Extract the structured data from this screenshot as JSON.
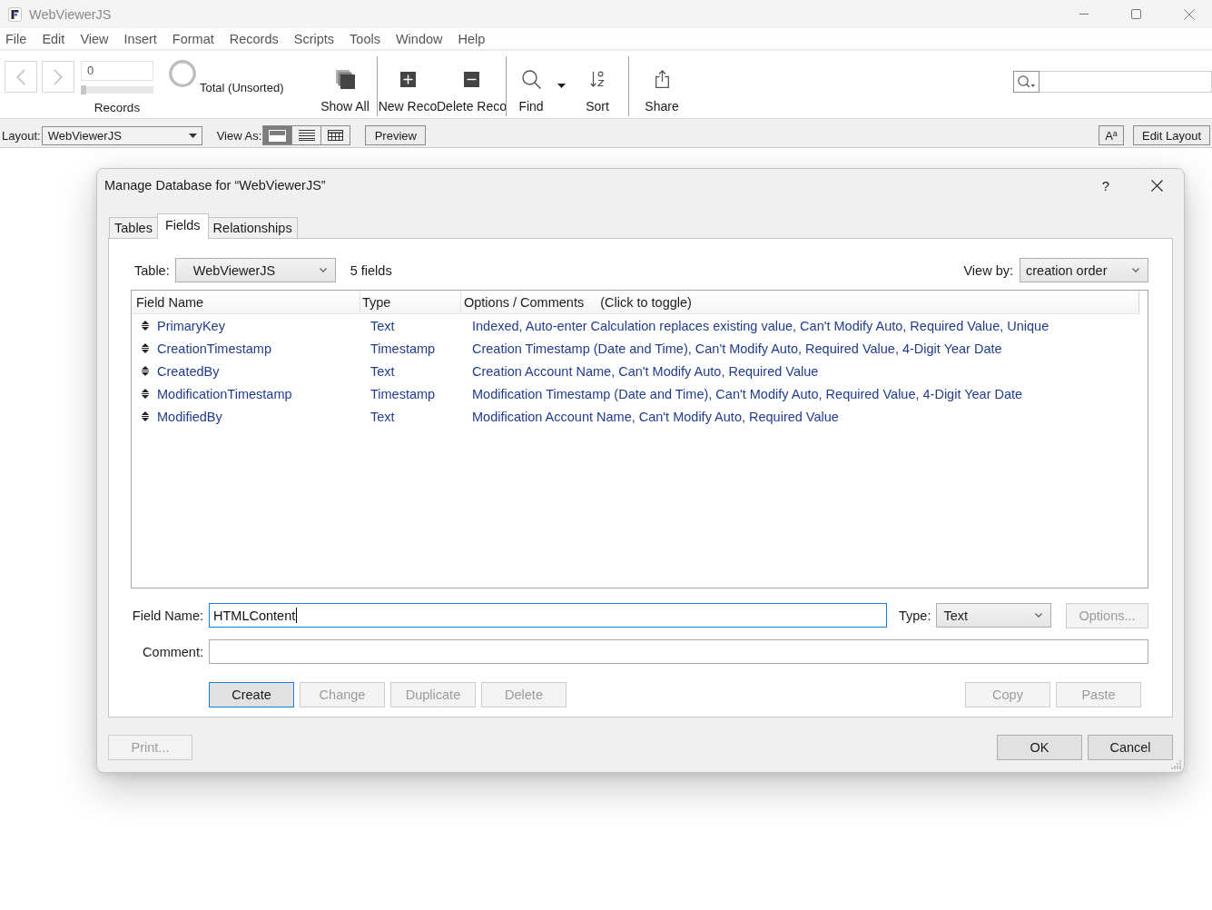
{
  "window": {
    "title": "WebViewerJS"
  },
  "menu": [
    "File",
    "Edit",
    "View",
    "Insert",
    "Format",
    "Records",
    "Scripts",
    "Tools",
    "Window",
    "Help"
  ],
  "toolbar": {
    "record_number": "0",
    "record_slider": {
      "level": 0
    },
    "records_label": "Records",
    "found_status": "Total (Unsorted)",
    "groups": [
      [
        {
          "kind": "show_all",
          "label": "Show All"
        }
      ],
      [
        {
          "kind": "new_record",
          "label": "New Reco"
        },
        {
          "kind": "delete_record",
          "label": "Delete Reco"
        }
      ],
      [
        {
          "kind": "find",
          "label": "Find"
        },
        {
          "kind": "menu_caret"
        },
        {
          "kind": "sort",
          "label": "Sort"
        }
      ],
      [
        {
          "kind": "share",
          "label": "Share"
        }
      ]
    ]
  },
  "layout_bar": {
    "layout_label": "Layout:",
    "layout": "WebViewerJS",
    "view_as_label": "View As:",
    "view_modes": [
      {
        "kind": "form",
        "selected": true
      },
      {
        "kind": "list",
        "selected": false
      },
      {
        "kind": "table",
        "selected": false
      }
    ],
    "preview": "Preview",
    "text_format": "A$^{a}$",
    "edit_layout": "Edit Layout"
  },
  "dialog": {
    "title": "Manage Database for “WebViewerJS”",
    "help": "?",
    "tabs": [
      {
        "label": "Tables",
        "selected": false
      },
      {
        "label": "Fields",
        "selected": true
      },
      {
        "label": "Relationships",
        "selected": false
      }
    ],
    "table_label": "Table:",
    "table": "WebViewerJS",
    "field_count": "5 fields",
    "view_by_label": "View by:",
    "view_by": "creation order",
    "fields_list": {
      "columns": [
        "Field Name",
        "Type",
        "Options / Comments"
      ],
      "toggle_hint": "(Click to toggle)",
      "rows": [
        {
          "name": "PrimaryKey",
          "type": "Text",
          "options": "Indexed, Auto-enter Calculation replaces existing value, Can't Modify Auto, Required Value, Unique"
        },
        {
          "name": "CreationTimestamp",
          "type": "Timestamp",
          "options": "Creation Timestamp (Date and Time), Can't Modify Auto, Required Value, 4-Digit Year Date"
        },
        {
          "name": "CreatedBy",
          "type": "Text",
          "options": "Creation Account Name, Can't Modify Auto, Required Value"
        },
        {
          "name": "ModificationTimestamp",
          "type": "Timestamp",
          "options": "Modification Timestamp (Date and Time), Can't Modify Auto, Required Value, 4-Digit Year Date"
        },
        {
          "name": "ModifiedBy",
          "type": "Text",
          "options": "Modification Account Name, Can't Modify Auto, Required Value"
        }
      ]
    },
    "field_name_label": "Field Name:",
    "field_name": {
      "value": "HTMLContent",
      "focused": true
    },
    "type_label": "Type:",
    "type": "Text",
    "options_button": {
      "label": "Options...",
      "disabled": true
    },
    "comment_label": "Comment:",
    "edit_buttons": [
      {
        "label": "Create",
        "disabled": false,
        "default": true
      },
      {
        "label": "Change",
        "disabled": true,
        "default": false
      },
      {
        "label": "Duplicate",
        "disabled": true,
        "default": false
      },
      {
        "label": "Delete",
        "disabled": true,
        "default": false
      }
    ],
    "clipboard_buttons": [
      {
        "label": "Copy",
        "disabled": true
      },
      {
        "label": "Paste",
        "disabled": true
      }
    ],
    "print_button": {
      "label": "Print...",
      "disabled": true
    },
    "ok_button": {
      "label": "OK",
      "disabled": false
    },
    "cancel_button": {
      "label": "Cancel",
      "disabled": false
    }
  }
}
